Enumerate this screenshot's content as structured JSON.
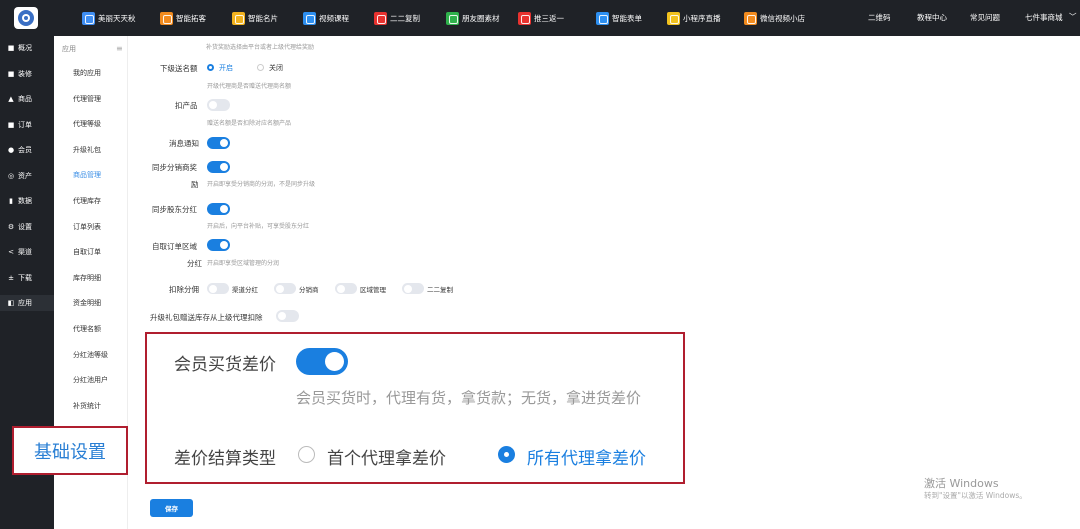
{
  "topbar": {
    "logo_icon": "app-logo-icon",
    "nav_items": [
      {
        "label": "美丽天天秋",
        "color": "#3f8ef2"
      },
      {
        "label": "智能拓客",
        "color": "#f28b1e"
      },
      {
        "label": "智能名片",
        "color": "#f2b21e"
      },
      {
        "label": "视频课程",
        "color": "#2d8ff0"
      },
      {
        "label": "二二复制",
        "color": "#e8322f"
      },
      {
        "label": "朋友圈素材",
        "color": "#2fb24c"
      },
      {
        "label": "推三返一",
        "color": "#e8322f"
      },
      {
        "label": "智能表单",
        "color": "#2d8ff0"
      },
      {
        "label": "小程序直播",
        "color": "#f2c21e"
      },
      {
        "label": "微信视频小店",
        "color": "#f28b1e"
      }
    ],
    "right_links": [
      "二维码",
      "教程中心",
      "常见问题",
      "七件事商城"
    ],
    "dropdown_icon": "chevron-down-icon"
  },
  "sidebar": {
    "items": [
      {
        "icon": "■",
        "label": "概况"
      },
      {
        "icon": "■",
        "label": "装修"
      },
      {
        "icon": "▲",
        "label": "商品"
      },
      {
        "icon": "■",
        "label": "订单"
      },
      {
        "icon": "●",
        "label": "会员"
      },
      {
        "icon": "◎",
        "label": "资产"
      },
      {
        "icon": "▮",
        "label": "数据"
      },
      {
        "icon": "⚙",
        "label": "设置"
      },
      {
        "icon": "<",
        "label": "渠道"
      },
      {
        "icon": "±",
        "label": "下载"
      },
      {
        "icon": "◧",
        "label": "应用"
      }
    ],
    "active_index": 10
  },
  "submenu": {
    "header": "应用",
    "menu_icon": "≡",
    "items": [
      "我的应用",
      "代理管理",
      "代理等级",
      "升级礼包",
      "商品管理",
      "代理库存",
      "订单列表",
      "自取订单",
      "库存明细",
      "资金明细",
      "代理名额",
      "分红池等级",
      "分红池用户",
      "补货统计"
    ],
    "active_index": 4,
    "basic_settings_label": "基础设置"
  },
  "form": {
    "top_hint": "补货奖励选择由平台或者上级代理给奖励",
    "quota": {
      "label": "下级送名额",
      "opt_on": "开启",
      "opt_off": "关闭",
      "value": "开启",
      "hint": "开级代理商是否赠送代理商名额"
    },
    "deduct_goods": {
      "label": "扣产品",
      "on": false,
      "hint": "赠送名额是否扣除对应名额产品"
    },
    "notify": {
      "label": "消息通知",
      "on": true
    },
    "sync_reward": {
      "label_1": "同步分销商奖",
      "label_2": "励",
      "on": true,
      "hint": "开启即享受分销商的分润，不是同步升级"
    },
    "sync_shareholder": {
      "label": "同步股东分红",
      "on": true,
      "hint": "开启后，向平台补贴，可享受股东分红"
    },
    "self_pickup": {
      "label_1": "自取订单区域",
      "label_2": "分红",
      "on": true,
      "hint": "开启即享受区域管理的分润"
    },
    "deduct_split": {
      "label": "扣除分佣",
      "options": [
        {
          "label": "渠道分红",
          "on": false
        },
        {
          "label": "分销商",
          "on": false
        },
        {
          "label": "区域管理",
          "on": false
        },
        {
          "label": "二二复制",
          "on": false
        }
      ]
    },
    "upgrade_gift": {
      "label": "升级礼包赠送库存从上级代理扣除",
      "on": false
    },
    "member_diff": {
      "label": "会员买货差价",
      "on": true,
      "hint": "会员买货时，代理有货，拿货款；无货，拿进货差价"
    },
    "settle_type": {
      "label": "差价结算类型",
      "opt_first": "首个代理拿差价",
      "opt_all": "所有代理拿差价",
      "value": "所有代理拿差价"
    },
    "save_label": "保存"
  },
  "watermark": {
    "line1": "激活 Windows",
    "line2": "转到\"设置\"以激活 Windows。"
  }
}
